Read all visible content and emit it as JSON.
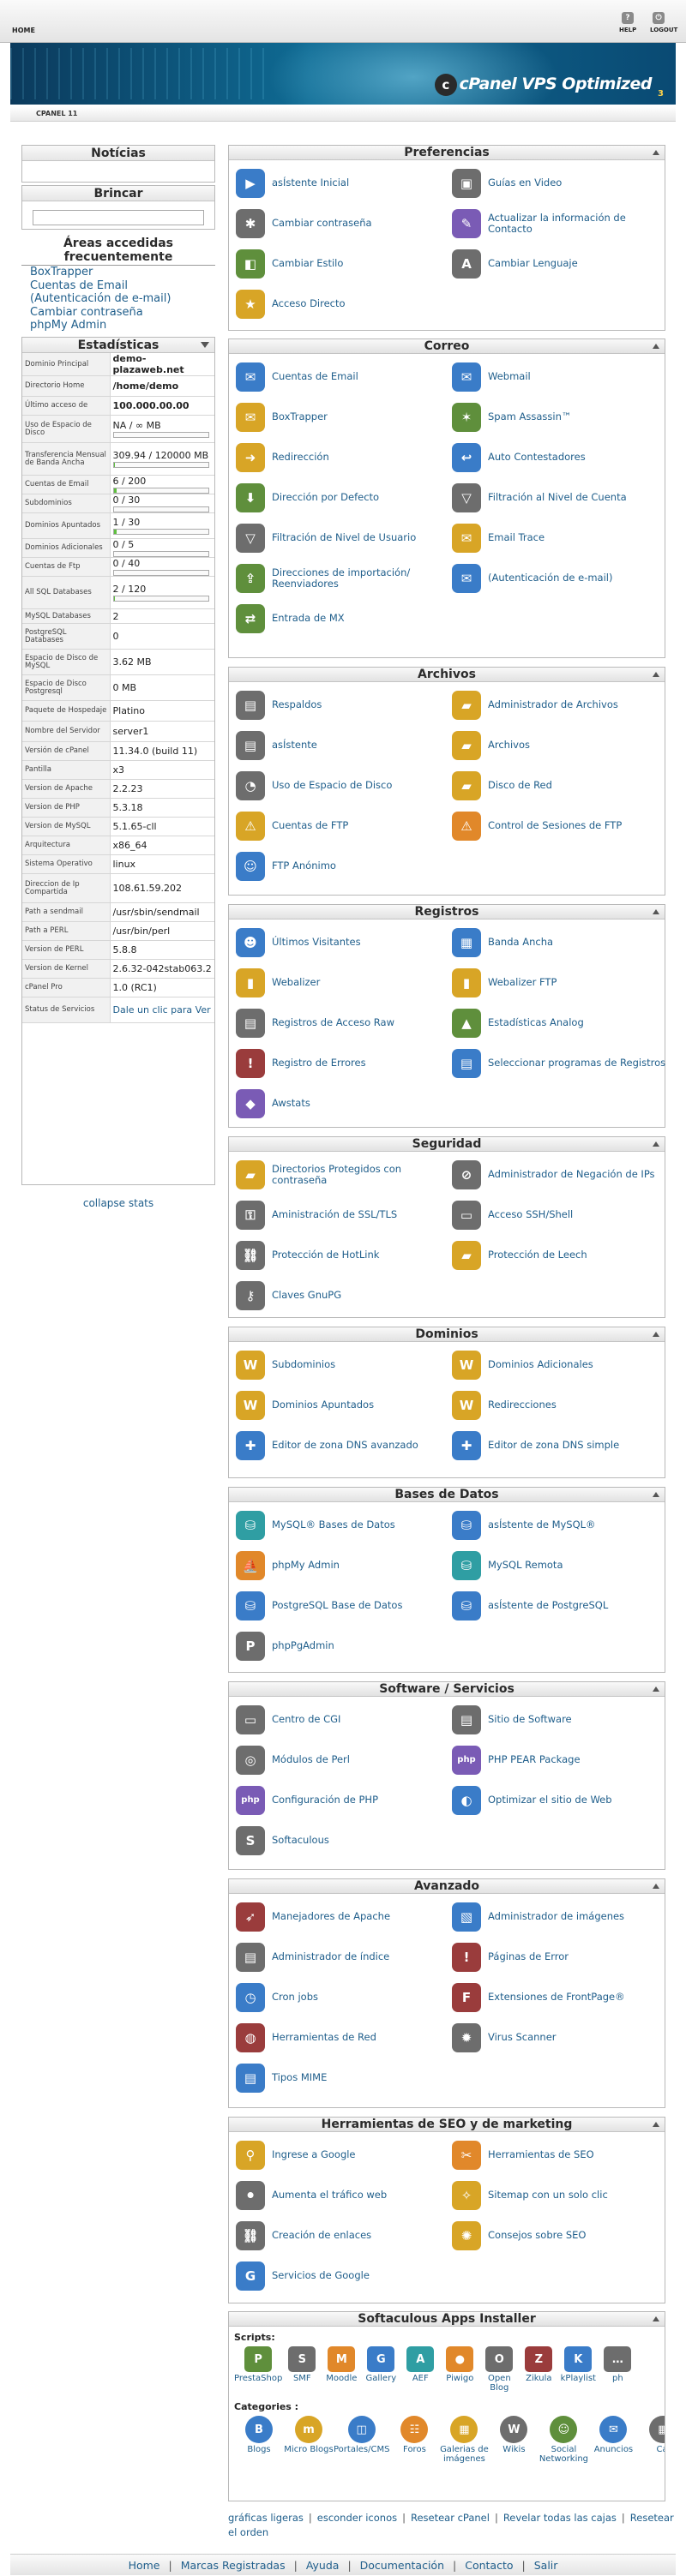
{
  "topbar": {
    "home": "HOME",
    "help": "HELP",
    "logout": "LOGOUT"
  },
  "banner": {
    "logo": "cPanel VPS Optimized",
    "version": "3"
  },
  "breadcrumb": "CPANEL 11",
  "sidebar": {
    "notes_title": "Notícias",
    "search_title": "Brincar",
    "frequent_title": "Áreas accedidas frecuentemente",
    "frequent": [
      "BoxTrapper",
      "Cuentas de Email",
      "(Autenticación de e-mail)",
      "Cambiar contraseña",
      "phpMy Admin"
    ],
    "stats_title": "Estadísticas",
    "stats": [
      {
        "k": "Dominio Principal",
        "v": "demo-plazaweb.net",
        "b": true
      },
      {
        "k": "Directorio Home",
        "v": "/home/demo",
        "b": true
      },
      {
        "k": "Último acceso de",
        "v": "100.000.00.00",
        "b": true
      },
      {
        "k": "Uso de Espacio de Disco",
        "v": "NA / ∞ MB",
        "bar": 0
      },
      {
        "k": "Transferencia Mensual de Banda Ancha",
        "v": "309.94 / 120000 MB",
        "bar": 0.3
      },
      {
        "k": "Cuentas de Email",
        "v": "6 / 200",
        "bar": 3
      },
      {
        "k": "Subdominios",
        "v": "0 / 30",
        "bar": 0
      },
      {
        "k": "Dominios Apuntados",
        "v": "1 / 30",
        "bar": 3.3
      },
      {
        "k": "Dominios Adicionales",
        "v": "0 / 5",
        "bar": 0
      },
      {
        "k": "Cuentas de Ftp",
        "v": "0 / 40",
        "bar": 0
      },
      {
        "k": "All SQL Databases",
        "v": "2 / 120",
        "bar": 1.7
      },
      {
        "k": "MySQL Databases",
        "v": "2"
      },
      {
        "k": "PostgreSQL Databases",
        "v": "0"
      },
      {
        "k": "Espacio de Disco de MySQL",
        "v": "3.62 MB"
      },
      {
        "k": "Espacio de Disco Postgresql",
        "v": "0 MB"
      },
      {
        "k": "Paquete de Hospedaje",
        "v": "Platino"
      },
      {
        "k": "Nombre del Servidor",
        "v": "server1"
      },
      {
        "k": "Versión de cPanel",
        "v": "11.34.0 (build 11)"
      },
      {
        "k": "Pantilla",
        "v": "x3"
      },
      {
        "k": "Version de Apache",
        "v": "2.2.23"
      },
      {
        "k": "Version de PHP",
        "v": "5.3.18"
      },
      {
        "k": "Version de MySQL",
        "v": "5.1.65-cll"
      },
      {
        "k": "Arquitectura",
        "v": "x86_64"
      },
      {
        "k": "Sistema Operativo",
        "v": "linux"
      },
      {
        "k": "Direccion de Ip Compartida",
        "v": "108.61.59.202"
      },
      {
        "k": "Path a sendmail",
        "v": "/usr/sbin/sendmail"
      },
      {
        "k": "Path a PERL",
        "v": "/usr/bin/perl"
      },
      {
        "k": "Version de PERL",
        "v": "5.8.8"
      },
      {
        "k": "Version de Kernel",
        "v": "2.6.32-042stab063.2"
      },
      {
        "k": "cPanel Pro",
        "v": "1.0 (RC1)"
      },
      {
        "k": "Status de Servicios",
        "v": "Dale un clic para Ver",
        "link": true
      }
    ],
    "collapse": "collapse stats"
  },
  "panels": [
    {
      "title": "Preferencias",
      "items": [
        {
          "label": "asÍstente Inicial",
          "icon": "wizard-icon",
          "c": "c1",
          "g": "▶"
        },
        {
          "label": "Guías en Video",
          "icon": "video-icon",
          "c": "c5",
          "g": "▣"
        },
        {
          "label": "Cambiar contraseña",
          "icon": "password-icon",
          "c": "c5",
          "g": "✱"
        },
        {
          "label": "Actualizar la información de Contacto",
          "icon": "contact-icon",
          "c": "c7",
          "g": "✎"
        },
        {
          "label": "Cambiar Estilo",
          "icon": "style-icon",
          "c": "c3",
          "g": "◧"
        },
        {
          "label": "Cambiar Lenguaje",
          "icon": "language-icon",
          "c": "c5",
          "g": "A"
        },
        {
          "label": "Acceso Directo",
          "icon": "star-icon",
          "c": "c2",
          "g": "★"
        }
      ]
    },
    {
      "title": "Correo",
      "items": [
        {
          "label": "Cuentas de Email",
          "icon": "email-icon",
          "c": "c1",
          "g": "✉"
        },
        {
          "label": "Webmail",
          "icon": "webmail-icon",
          "c": "c1",
          "g": "✉"
        },
        {
          "label": "BoxTrapper",
          "icon": "boxtrapper-icon",
          "c": "c2",
          "g": "✉"
        },
        {
          "label": "Spam Assassin™",
          "icon": "spam-icon",
          "c": "c3",
          "g": "✶"
        },
        {
          "label": "Redirección",
          "icon": "forwarder-icon",
          "c": "c2",
          "g": "➜"
        },
        {
          "label": "Auto Contestadores",
          "icon": "autoresponder-icon",
          "c": "c1",
          "g": "↩"
        },
        {
          "label": "Dirección por Defecto",
          "icon": "default-address-icon",
          "c": "c3",
          "g": "⬇"
        },
        {
          "label": "Filtración al Nivel de Cuenta",
          "icon": "account-filter-icon",
          "c": "c5",
          "g": "▽"
        },
        {
          "label": "Filtración de Nivel de Usuario",
          "icon": "user-filter-icon",
          "c": "c5",
          "g": "▽"
        },
        {
          "label": "Email Trace",
          "icon": "trace-icon",
          "c": "c2",
          "g": "✉"
        },
        {
          "label": "Direcciones de importación/ Reenviadores",
          "icon": "import-icon",
          "c": "c3",
          "g": "⇪"
        },
        {
          "label": "(Autenticación de e-mail)",
          "icon": "auth-icon",
          "c": "c1",
          "g": "✉"
        },
        {
          "label": "Entrada de MX",
          "icon": "mx-icon",
          "c": "c3",
          "g": "⇄"
        }
      ]
    },
    {
      "title": "Archivos",
      "items": [
        {
          "label": "Respaldos",
          "icon": "backup-icon",
          "c": "c5",
          "g": "▤"
        },
        {
          "label": "Administrador de Archivos",
          "icon": "file-manager-icon",
          "c": "c2",
          "g": "▰"
        },
        {
          "label": "asÍstente",
          "icon": "backup-wizard-icon",
          "c": "c5",
          "g": "▤"
        },
        {
          "label": "Archivos",
          "icon": "files-icon",
          "c": "c2",
          "g": "▰"
        },
        {
          "label": "Uso de Espacio de Disco",
          "icon": "disk-usage-icon",
          "c": "c5",
          "g": "◔"
        },
        {
          "label": "Disco de Red",
          "icon": "network-disk-icon",
          "c": "c2",
          "g": "▰"
        },
        {
          "label": "Cuentas de FTP",
          "icon": "ftp-icon",
          "c": "c2",
          "g": "⚠"
        },
        {
          "label": "Control de Sesiones de FTP",
          "icon": "ftp-session-icon",
          "c": "c6",
          "g": "⚠"
        },
        {
          "label": "FTP Anónimo",
          "icon": "anon-ftp-icon",
          "c": "c1",
          "g": "☺"
        }
      ]
    },
    {
      "title": "Registros",
      "items": [
        {
          "label": "Últimos Visitantes",
          "icon": "visitors-icon",
          "c": "c1",
          "g": "☻"
        },
        {
          "label": "Banda Ancha",
          "icon": "bandwidth-icon",
          "c": "c1",
          "g": "▦"
        },
        {
          "label": "Webalizer",
          "icon": "webalizer-icon",
          "c": "c2",
          "g": "▮"
        },
        {
          "label": "Webalizer FTP",
          "icon": "webalizer-ftp-icon",
          "c": "c2",
          "g": "▮"
        },
        {
          "label": "Registros de Acceso Raw",
          "icon": "raw-log-icon",
          "c": "c5",
          "g": "▤"
        },
        {
          "label": "Estadísticas Analog",
          "icon": "analog-icon",
          "c": "c3",
          "g": "▲"
        },
        {
          "label": "Registro de Errores",
          "icon": "error-log-icon",
          "c": "c4",
          "g": "!"
        },
        {
          "label": "Seleccionar programas de Registros",
          "icon": "log-programs-icon",
          "c": "c1",
          "g": "▤"
        },
        {
          "label": "Awstats",
          "icon": "awstats-icon",
          "c": "c7",
          "g": "◆"
        }
      ]
    },
    {
      "title": "Seguridad",
      "items": [
        {
          "label": "Directorios Protegidos con contraseña",
          "icon": "protected-dir-icon",
          "c": "c2",
          "g": "▰"
        },
        {
          "label": "Administrador de Negación de IPs",
          "icon": "ip-deny-icon",
          "c": "c5",
          "g": "⊘"
        },
        {
          "label": "Aministración de SSL/TLS",
          "icon": "ssl-icon",
          "c": "c5",
          "g": "⚿"
        },
        {
          "label": "Acceso SSH/Shell",
          "icon": "ssh-icon",
          "c": "c5",
          "g": "▭"
        },
        {
          "label": "Protección de HotLink",
          "icon": "hotlink-icon",
          "c": "c5",
          "g": "⛓"
        },
        {
          "label": "Protección de Leech",
          "icon": "leech-icon",
          "c": "c2",
          "g": "▰"
        },
        {
          "label": "Claves GnuPG",
          "icon": "gnupg-icon",
          "c": "c5",
          "g": "⚷"
        }
      ]
    },
    {
      "title": "Dominios",
      "items": [
        {
          "label": "Subdominios",
          "icon": "subdomains-icon",
          "c": "c2",
          "g": "W"
        },
        {
          "label": "Dominios Adicionales",
          "icon": "addon-domains-icon",
          "c": "c2",
          "g": "W"
        },
        {
          "label": "Dominios Apuntados",
          "icon": "parked-domains-icon",
          "c": "c2",
          "g": "W"
        },
        {
          "label": "Redirecciones",
          "icon": "redirects-icon",
          "c": "c2",
          "g": "W"
        },
        {
          "label": "Editor de zona DNS avanzado",
          "icon": "dns-advanced-icon",
          "c": "c1",
          "g": "✚"
        },
        {
          "label": "Editor de zona DNS simple",
          "icon": "dns-simple-icon",
          "c": "c1",
          "g": "✚"
        }
      ]
    },
    {
      "title": "Bases de Datos",
      "items": [
        {
          "label": "MySQL® Bases de Datos",
          "icon": "mysql-icon",
          "c": "c8",
          "g": "⛁"
        },
        {
          "label": "asÍstente de MySQL®",
          "icon": "mysql-wizard-icon",
          "c": "c1",
          "g": "⛁"
        },
        {
          "label": "phpMy Admin",
          "icon": "phpmyadmin-icon",
          "c": "c6",
          "g": "⛵"
        },
        {
          "label": "MySQL Remota",
          "icon": "remote-mysql-icon",
          "c": "c8",
          "g": "⛁"
        },
        {
          "label": "PostgreSQL Base de Datos",
          "icon": "postgresql-icon",
          "c": "c1",
          "g": "⛁"
        },
        {
          "label": "asÍstente de PostgreSQL",
          "icon": "postgresql-wizard-icon",
          "c": "c1",
          "g": "⛁"
        },
        {
          "label": "phpPgAdmin",
          "icon": "phppgadmin-icon",
          "c": "c5",
          "g": "P"
        }
      ]
    },
    {
      "title": "Software / Servicios",
      "items": [
        {
          "label": "Centro de CGI",
          "icon": "cgi-icon",
          "c": "c5",
          "g": "▭"
        },
        {
          "label": "Sitio de Software",
          "icon": "software-icon",
          "c": "c5",
          "g": "▤"
        },
        {
          "label": "Módulos de Perl",
          "icon": "perl-icon",
          "c": "c5",
          "g": "◎"
        },
        {
          "label": "PHP PEAR Package",
          "icon": "pear-icon",
          "c": "c7",
          "g": "php"
        },
        {
          "label": "Configuración de PHP",
          "icon": "php-config-icon",
          "c": "c7",
          "g": "php"
        },
        {
          "label": "Optimizar el sitio de Web",
          "icon": "optimize-icon",
          "c": "c1",
          "g": "◐"
        },
        {
          "label": "Softaculous",
          "icon": "softaculous-icon",
          "c": "c5",
          "g": "S"
        }
      ]
    },
    {
      "title": "Avanzado",
      "items": [
        {
          "label": "Manejadores de Apache",
          "icon": "apache-icon",
          "c": "c4",
          "g": "➶"
        },
        {
          "label": "Administrador de imágenes",
          "icon": "images-icon",
          "c": "c1",
          "g": "▧"
        },
        {
          "label": "Administrador de índice",
          "icon": "index-icon",
          "c": "c5",
          "g": "▤"
        },
        {
          "label": "Páginas de Error",
          "icon": "error-pages-icon",
          "c": "c4",
          "g": "!"
        },
        {
          "label": "Cron jobs",
          "icon": "cron-icon",
          "c": "c1",
          "g": "◷"
        },
        {
          "label": "Extensiones de FrontPage®",
          "icon": "frontpage-icon",
          "c": "c4",
          "g": "F"
        },
        {
          "label": "Herramientas de Red",
          "icon": "network-tools-icon",
          "c": "c4",
          "g": "◍"
        },
        {
          "label": "Virus Scanner",
          "icon": "virus-icon",
          "c": "c5",
          "g": "✹"
        },
        {
          "label": "Tipos MIME",
          "icon": "mime-icon",
          "c": "c1",
          "g": "▤"
        }
      ]
    },
    {
      "title": "Herramientas de SEO y de marketing",
      "items": [
        {
          "label": "Ingrese a Google",
          "icon": "google-submit-icon",
          "c": "c2",
          "g": "⚲"
        },
        {
          "label": "Herramientas de SEO",
          "icon": "seo-tools-icon",
          "c": "c6",
          "g": "✂"
        },
        {
          "label": "Aumenta el tráfico web",
          "icon": "traffic-icon",
          "c": "c5",
          "g": "⚫"
        },
        {
          "label": "Sitemap con un solo clic",
          "icon": "sitemap-icon",
          "c": "c2",
          "g": "✧"
        },
        {
          "label": "Creación de enlaces",
          "icon": "links-icon",
          "c": "c5",
          "g": "⛓"
        },
        {
          "label": "Consejos sobre SEO",
          "icon": "seo-tips-icon",
          "c": "c2",
          "g": "✺"
        },
        {
          "label": "Servicios de Google",
          "icon": "google-services-icon",
          "c": "c1",
          "g": "G"
        }
      ]
    }
  ],
  "softaculous": {
    "title": "Softaculous Apps Installer",
    "scripts_label": "Scripts:",
    "scripts": [
      {
        "label": "PrestaShop",
        "icon": "prestashop-icon",
        "c": "c3",
        "g": "P"
      },
      {
        "label": "SMF",
        "icon": "smf-icon",
        "c": "c5",
        "g": "S"
      },
      {
        "label": "Moodle",
        "icon": "moodle-icon",
        "c": "c6",
        "g": "M"
      },
      {
        "label": "Gallery",
        "icon": "gallery-icon",
        "c": "c1",
        "g": "G"
      },
      {
        "label": "AEF",
        "icon": "aef-icon",
        "c": "c8",
        "g": "A"
      },
      {
        "label": "Piwigo",
        "icon": "piwigo-icon",
        "c": "c6",
        "g": "●"
      },
      {
        "label": "Open Blog",
        "icon": "openblog-icon",
        "c": "c5",
        "g": "O"
      },
      {
        "label": "Zikula",
        "icon": "zikula-icon",
        "c": "c4",
        "g": "Z"
      },
      {
        "label": "kPlaylist",
        "icon": "kplaylist-icon",
        "c": "c1",
        "g": "K"
      },
      {
        "label": "ph",
        "icon": "more-scripts-icon",
        "c": "c5",
        "g": "…"
      }
    ],
    "categories_label": "Categories :",
    "categories": [
      {
        "label": "Blogs",
        "icon": "blogs-icon",
        "c": "c1",
        "g": "B"
      },
      {
        "label": "Micro Blogs",
        "icon": "microblogs-icon",
        "c": "c2",
        "g": "m"
      },
      {
        "label": "Portales/CMS",
        "icon": "cms-icon",
        "c": "c1",
        "g": "◫"
      },
      {
        "label": "Foros",
        "icon": "forums-icon",
        "c": "c6",
        "g": "☷"
      },
      {
        "label": "Galerias de imágenes",
        "icon": "image-galleries-icon",
        "c": "c2",
        "g": "▦"
      },
      {
        "label": "Wikis",
        "icon": "wikis-icon",
        "c": "c5",
        "g": "W"
      },
      {
        "label": "Social Networking",
        "icon": "social-icon",
        "c": "c3",
        "g": "☺"
      },
      {
        "label": "Anuncios",
        "icon": "ads-icon",
        "c": "c1",
        "g": "✉"
      },
      {
        "label": "Cal",
        "icon": "calendar-icon",
        "c": "c5",
        "g": "▦"
      }
    ]
  },
  "footer_links": [
    "gráficas ligeras",
    "esconder iconos",
    "Resetear cPanel",
    "Revelar todas las cajas",
    "Resetear el orden"
  ],
  "footer": [
    "Home",
    "Marcas Registradas",
    "Ayuda",
    "Documentación",
    "Contacto",
    "Salir"
  ]
}
